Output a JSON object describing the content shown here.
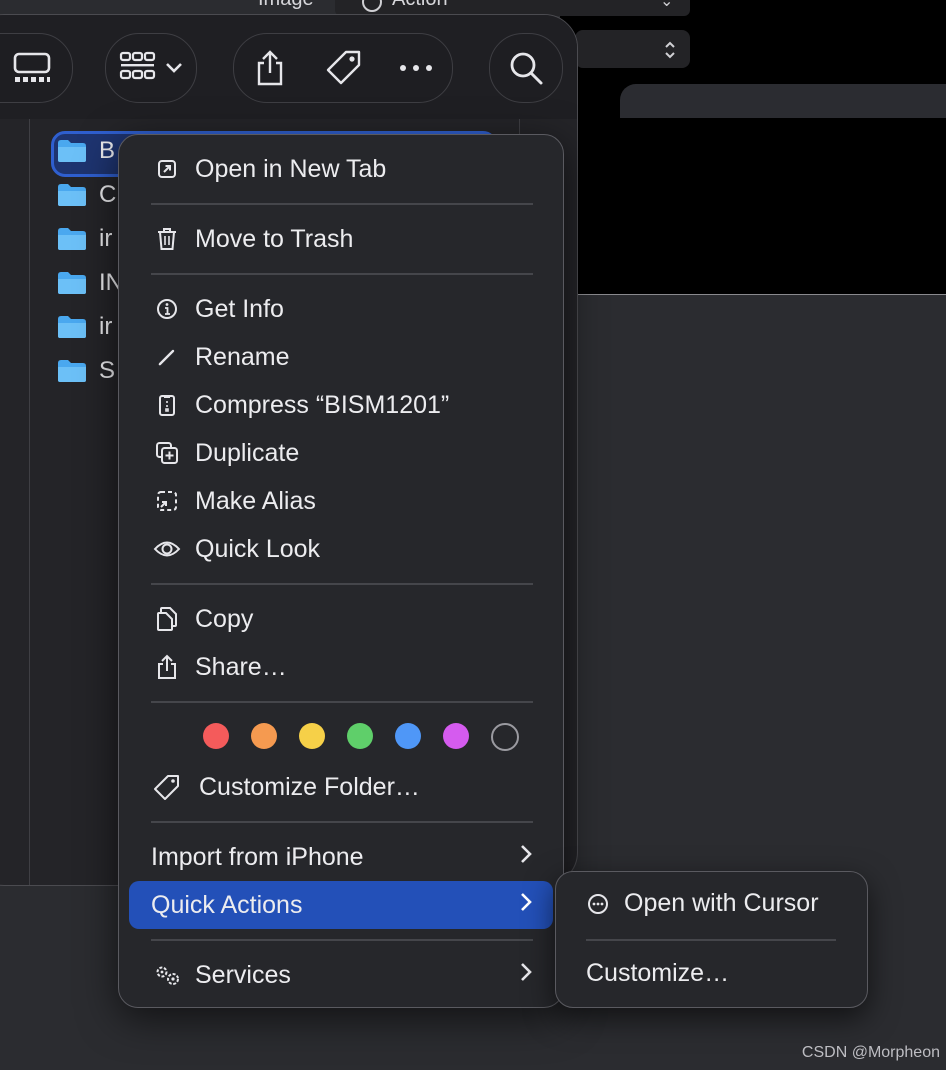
{
  "background_popups": {
    "label": "Image",
    "value": "Action"
  },
  "toolbar": {
    "view_icon": "gallery-view-icon",
    "group_icon": "grid-group-icon",
    "share_icon": "share-icon",
    "tag_icon": "tag-icon",
    "more_icon": "ellipsis-icon",
    "search_icon": "search-icon"
  },
  "folders": [
    {
      "name": "B"
    },
    {
      "name": "C"
    },
    {
      "name": "ir"
    },
    {
      "name": "IN"
    },
    {
      "name": "ir"
    },
    {
      "name": "S"
    }
  ],
  "context_menu": {
    "open_in_new_tab": "Open in New Tab",
    "move_to_trash": "Move to Trash",
    "get_info": "Get Info",
    "rename": "Rename",
    "compress": "Compress “BISM1201”",
    "duplicate": "Duplicate",
    "make_alias": "Make Alias",
    "quick_look": "Quick Look",
    "copy": "Copy",
    "share": "Share…",
    "customize_folder": "Customize Folder…",
    "import_from_iphone": "Import from iPhone",
    "quick_actions": "Quick Actions",
    "services": "Services",
    "tag_colors": [
      "#f45b5b",
      "#f59a50",
      "#f6d048",
      "#5fcf6a",
      "#4f97f7",
      "#d55bef",
      "none"
    ]
  },
  "submenu": {
    "open_with_cursor": "Open with Cursor",
    "customize": "Customize…"
  },
  "watermark": "CSDN @Morpheon",
  "accent_color": "#2350b8"
}
